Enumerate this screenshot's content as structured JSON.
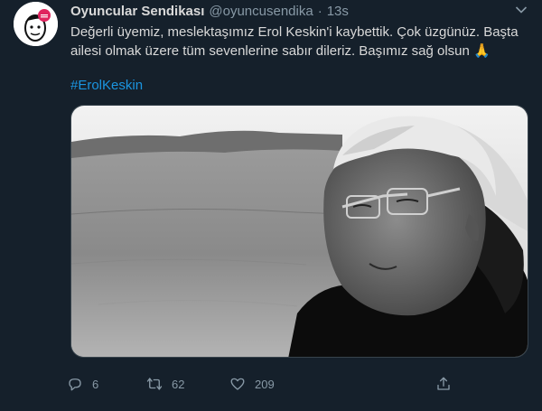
{
  "tweet": {
    "author_name": "Oyuncular Sendikası",
    "author_handle": "@oyuncusendika",
    "separator": "·",
    "time": "13s",
    "text": "Değerli üyemiz, meslektaşımız Erol Keskin'i kaybettik. Çok üzgünüz. Başta ailesi olmak üzere tüm sevenlerine sabır dileriz. Başımız sağ olsun 🙏",
    "hashtag": "#ErolKeskin"
  },
  "actions": {
    "reply_count": "6",
    "retweet_count": "62",
    "like_count": "209"
  },
  "icons": {
    "more": "chevron-down-icon",
    "reply": "comment-icon",
    "retweet": "retweet-icon",
    "like": "heart-icon",
    "share": "share-icon"
  },
  "colors": {
    "background": "#15202b",
    "text": "#d9d9d9",
    "muted": "#8899a6",
    "link": "#1b95e0"
  }
}
